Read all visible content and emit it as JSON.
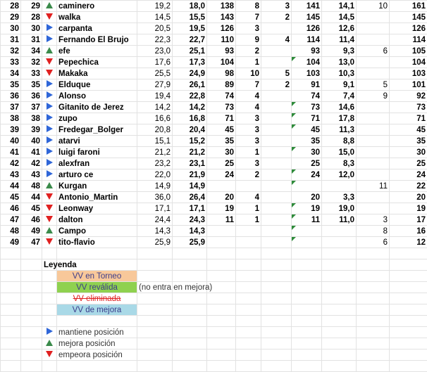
{
  "rows": [
    {
      "r": "28",
      "p": "29",
      "m": "up",
      "name": "caminero",
      "a": "19,2",
      "b": "18,0",
      "c": "138",
      "d": "8",
      "e": "3",
      "f": "141",
      "g": "14,1",
      "h": "10",
      "i": "161",
      "fg": false
    },
    {
      "r": "29",
      "p": "28",
      "m": "down",
      "name": "walka",
      "a": "14,5",
      "b": "15,5",
      "c": "143",
      "d": "7",
      "e": "2",
      "f": "145",
      "g": "14,5",
      "h": "",
      "i": "145",
      "fg": false
    },
    {
      "r": "30",
      "p": "30",
      "m": "right",
      "name": "carpanta",
      "a": "20,5",
      "b": "19,5",
      "c": "126",
      "d": "3",
      "e": "",
      "f": "126",
      "g": "12,6",
      "h": "",
      "i": "126",
      "fg": false
    },
    {
      "r": "31",
      "p": "31",
      "m": "right",
      "name": "Fernando El Brujo",
      "a": "22,3",
      "b": "22,7",
      "c": "110",
      "d": "9",
      "e": "4",
      "f": "114",
      "g": "11,4",
      "h": "",
      "i": "114",
      "fg": false
    },
    {
      "r": "32",
      "p": "34",
      "m": "up",
      "name": "efe",
      "a": "23,0",
      "b": "25,1",
      "c": "93",
      "d": "2",
      "e": "",
      "f": "93",
      "g": "9,3",
      "h": "6",
      "i": "105",
      "fg": false
    },
    {
      "r": "33",
      "p": "32",
      "m": "down",
      "name": "Pepechica",
      "a": "17,6",
      "b": "17,3",
      "c": "104",
      "d": "1",
      "e": "",
      "f": "104",
      "g": "13,0",
      "h": "",
      "i": "104",
      "fg": true
    },
    {
      "r": "34",
      "p": "33",
      "m": "down",
      "name": "Makaka",
      "a": "25,5",
      "b": "24,9",
      "c": "98",
      "d": "10",
      "e": "5",
      "f": "103",
      "g": "10,3",
      "h": "",
      "i": "103",
      "fg": false
    },
    {
      "r": "35",
      "p": "35",
      "m": "right",
      "name": "Elduque",
      "a": "27,9",
      "b": "26,1",
      "c": "89",
      "d": "7",
      "e": "2",
      "f": "91",
      "g": "9,1",
      "h": "5",
      "i": "101",
      "fg": false
    },
    {
      "r": "36",
      "p": "36",
      "m": "right",
      "name": "Alonso",
      "a": "19,4",
      "b": "22,8",
      "c": "74",
      "d": "4",
      "e": "",
      "f": "74",
      "g": "7,4",
      "h": "9",
      "i": "92",
      "fg": false
    },
    {
      "r": "37",
      "p": "37",
      "m": "right",
      "name": "Gitanito de Jerez",
      "a": "14,2",
      "b": "14,2",
      "c": "73",
      "d": "4",
      "e": "",
      "f": "73",
      "g": "14,6",
      "h": "",
      "i": "73",
      "fg": true
    },
    {
      "r": "38",
      "p": "38",
      "m": "right",
      "name": "zupo",
      "a": "16,6",
      "b": "16,8",
      "c": "71",
      "d": "3",
      "e": "",
      "f": "71",
      "g": "17,8",
      "h": "",
      "i": "71",
      "fg": true
    },
    {
      "r": "39",
      "p": "39",
      "m": "right",
      "name": "Fredegar_Bolger",
      "a": "20,8",
      "b": "20,4",
      "c": "45",
      "d": "3",
      "e": "",
      "f": "45",
      "g": "11,3",
      "h": "",
      "i": "45",
      "fg": true
    },
    {
      "r": "40",
      "p": "40",
      "m": "right",
      "name": "atarvi",
      "a": "15,1",
      "b": "15,2",
      "c": "35",
      "d": "3",
      "e": "",
      "f": "35",
      "g": "8,8",
      "h": "",
      "i": "35",
      "fg": false
    },
    {
      "r": "41",
      "p": "41",
      "m": "right",
      "name": "luigi faroni",
      "a": "21,2",
      "b": "21,2",
      "c": "30",
      "d": "1",
      "e": "",
      "f": "30",
      "g": "15,0",
      "h": "",
      "i": "30",
      "fg": true
    },
    {
      "r": "42",
      "p": "42",
      "m": "right",
      "name": "alexfran",
      "a": "23,2",
      "b": "23,1",
      "c": "25",
      "d": "3",
      "e": "",
      "f": "25",
      "g": "8,3",
      "h": "",
      "i": "25",
      "fg": false
    },
    {
      "r": "43",
      "p": "43",
      "m": "right",
      "name": "arturo ce",
      "a": "22,0",
      "b": "21,9",
      "c": "24",
      "d": "2",
      "e": "",
      "f": "24",
      "g": "12,0",
      "h": "",
      "i": "24",
      "fg": true
    },
    {
      "r": "44",
      "p": "48",
      "m": "up",
      "name": "Kurgan",
      "a": "14,9",
      "b": "14,9",
      "c": "",
      "d": "",
      "e": "",
      "f": "",
      "g": "",
      "h": "11",
      "i": "22",
      "fg": true
    },
    {
      "r": "45",
      "p": "44",
      "m": "down",
      "name": "Antonio_Martin",
      "a": "36,0",
      "b": "26,4",
      "c": "20",
      "d": "4",
      "e": "",
      "f": "20",
      "g": "3,3",
      "h": "",
      "i": "20",
      "fg": false
    },
    {
      "r": "46",
      "p": "45",
      "m": "down",
      "name": "Leonway",
      "a": "17,1",
      "b": "17,1",
      "c": "19",
      "d": "1",
      "e": "",
      "f": "19",
      "g": "19,0",
      "h": "",
      "i": "19",
      "fg": true
    },
    {
      "r": "47",
      "p": "46",
      "m": "down",
      "name": "dalton",
      "a": "24,4",
      "b": "24,3",
      "c": "11",
      "d": "1",
      "e": "",
      "f": "11",
      "g": "11,0",
      "h": "3",
      "i": "17",
      "fg": true
    },
    {
      "r": "48",
      "p": "49",
      "m": "up",
      "name": "Campo",
      "a": "14,3",
      "b": "14,3",
      "c": "",
      "d": "",
      "e": "",
      "f": "",
      "g": "",
      "h": "8",
      "i": "16",
      "fg": true
    },
    {
      "r": "49",
      "p": "47",
      "m": "down",
      "name": "tito-flavio",
      "a": "25,9",
      "b": "25,9",
      "c": "",
      "d": "",
      "e": "",
      "f": "",
      "g": "",
      "h": "6",
      "i": "12",
      "fg": true
    }
  ],
  "legend": {
    "title": "Leyenda",
    "torneo": "VV en Torneo",
    "revalida": "VV reválida",
    "revalida_note": "(no entra en mejora)",
    "eliminada": "VV eliminada",
    "mejora": "VV de mejora",
    "mantiene": "mantiene posición",
    "mejora_pos": "mejora posición",
    "empeora": "empeora posición"
  },
  "colors": {
    "up": "#3a8a4a",
    "down": "#e02020",
    "right": "#2f66d8",
    "torneo": "#f8c89a",
    "revalida": "#8fd14f",
    "mejora": "#a9d9e7"
  }
}
